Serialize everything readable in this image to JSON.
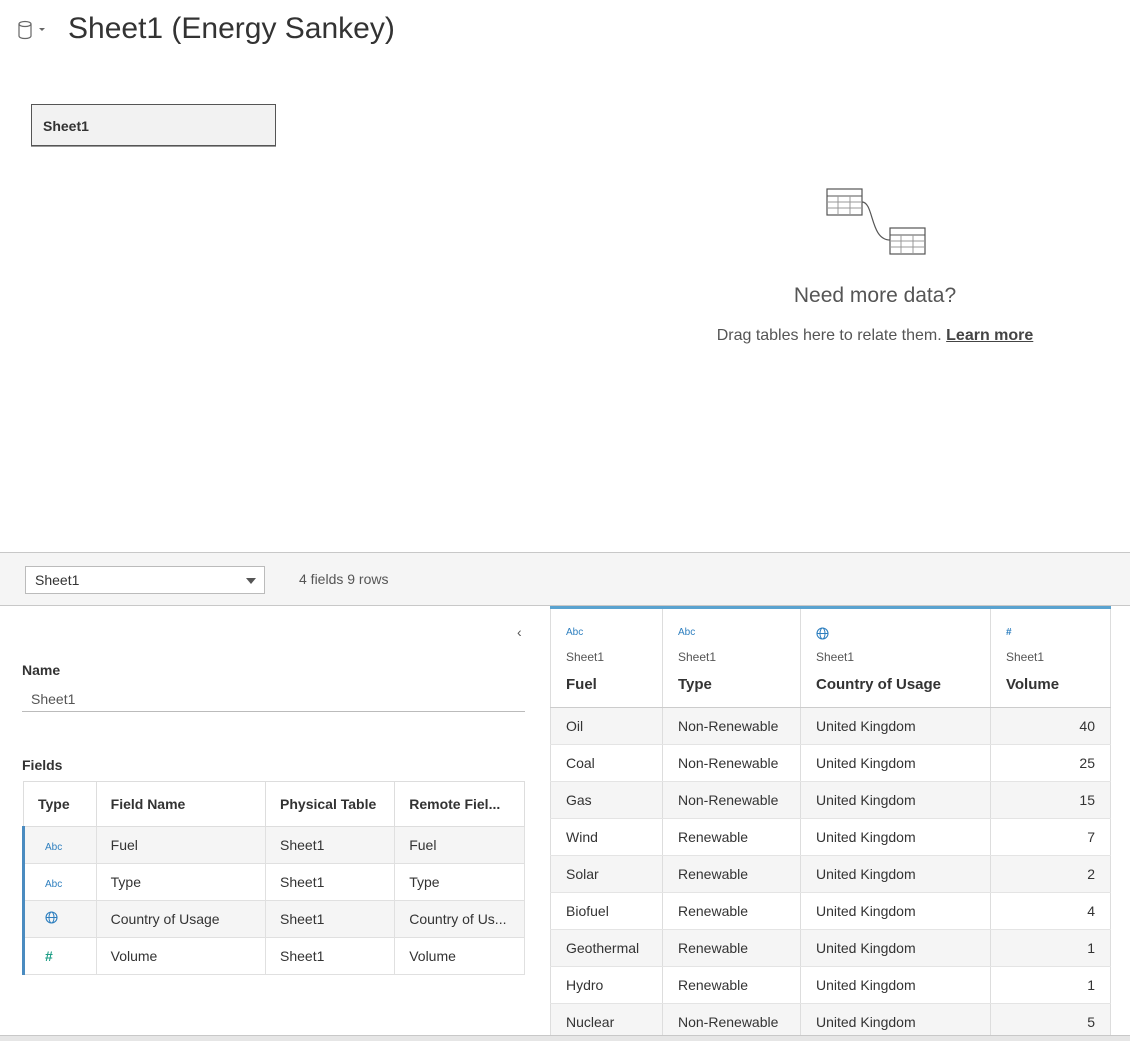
{
  "header": {
    "title": "Sheet1 (Energy Sankey)",
    "datasource_icon": "database-icon"
  },
  "canvas": {
    "sheet_box_label": "Sheet1",
    "empty_title": "Need more data?",
    "empty_hint": "Drag tables here to relate them.",
    "learn_more": "Learn more"
  },
  "toolbar": {
    "table_select_value": "Sheet1",
    "field_count": "4 fields 9 rows"
  },
  "left_panel": {
    "name_label": "Name",
    "name_value": "Sheet1",
    "fields_label": "Fields",
    "columns": [
      "Type",
      "Field Name",
      "Physical Table",
      "Remote Fiel..."
    ],
    "rows": [
      {
        "type_icon": "Abc",
        "field_name": "Fuel",
        "physical_table": "Sheet1",
        "remote_field": "Fuel"
      },
      {
        "type_icon": "Abc",
        "field_name": "Type",
        "physical_table": "Sheet1",
        "remote_field": "Type"
      },
      {
        "type_icon": "globe",
        "field_name": "Country of Usage",
        "physical_table": "Sheet1",
        "remote_field": "Country of Us..."
      },
      {
        "type_icon": "#",
        "field_name": "Volume",
        "physical_table": "Sheet1",
        "remote_field": "Volume"
      }
    ]
  },
  "grid": {
    "columns": [
      {
        "icon": "Abc",
        "source": "Sheet1",
        "name": "Fuel"
      },
      {
        "icon": "Abc",
        "source": "Sheet1",
        "name": "Type"
      },
      {
        "icon": "globe",
        "source": "Sheet1",
        "name": "Country of Usage"
      },
      {
        "icon": "#",
        "source": "Sheet1",
        "name": "Volume"
      }
    ],
    "rows": [
      [
        "Oil",
        "Non-Renewable",
        "United Kingdom",
        "40"
      ],
      [
        "Coal",
        "Non-Renewable",
        "United Kingdom",
        "25"
      ],
      [
        "Gas",
        "Non-Renewable",
        "United Kingdom",
        "15"
      ],
      [
        "Wind",
        "Renewable",
        "United Kingdom",
        "7"
      ],
      [
        "Solar",
        "Renewable",
        "United Kingdom",
        "2"
      ],
      [
        "Biofuel",
        "Renewable",
        "United Kingdom",
        "4"
      ],
      [
        "Geothermal",
        "Renewable",
        "United Kingdom",
        "1"
      ],
      [
        "Hydro",
        "Renewable",
        "United Kingdom",
        "1"
      ],
      [
        "Nuclear",
        "Non-Renewable",
        "United Kingdom",
        "5"
      ]
    ]
  }
}
